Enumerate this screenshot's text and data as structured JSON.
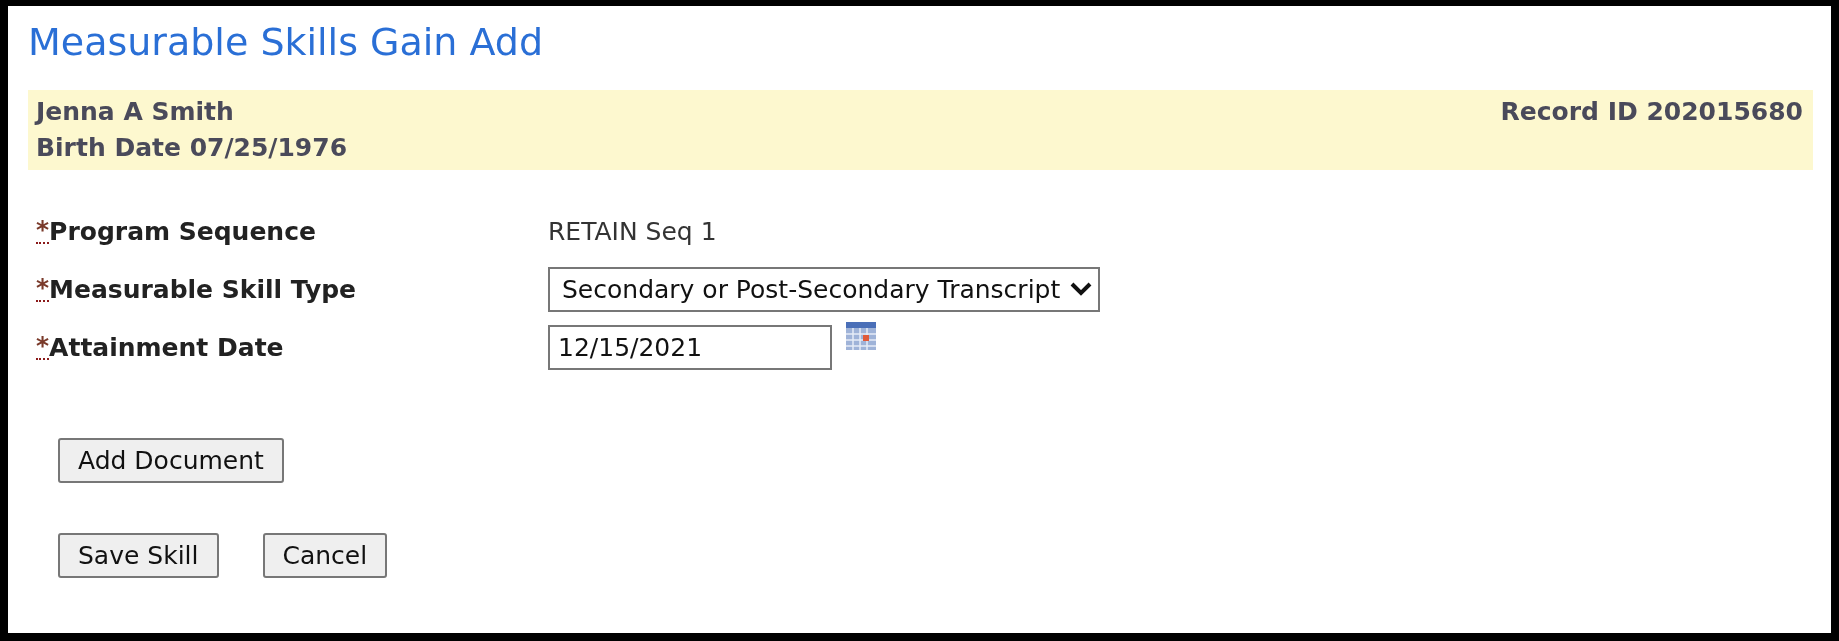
{
  "title": "Measurable Skills Gain Add",
  "person": {
    "name": "Jenna A Smith",
    "birth_date": "Birth Date 07/25/1976",
    "record_id": "Record ID 202015680"
  },
  "fields": [
    {
      "kind": "text",
      "required_mark": "*",
      "label": "Program Sequence",
      "value": "RETAIN Seq 1"
    },
    {
      "kind": "select",
      "required_mark": "*",
      "label": "Measurable Skill Type",
      "value": "Secondary or Post-Secondary Transcript"
    },
    {
      "kind": "date",
      "required_mark": "*",
      "label": "Attainment Date",
      "value": "12/15/2021"
    }
  ],
  "document_button": "Add Document",
  "buttons": [
    "Save Skill",
    "Cancel"
  ]
}
